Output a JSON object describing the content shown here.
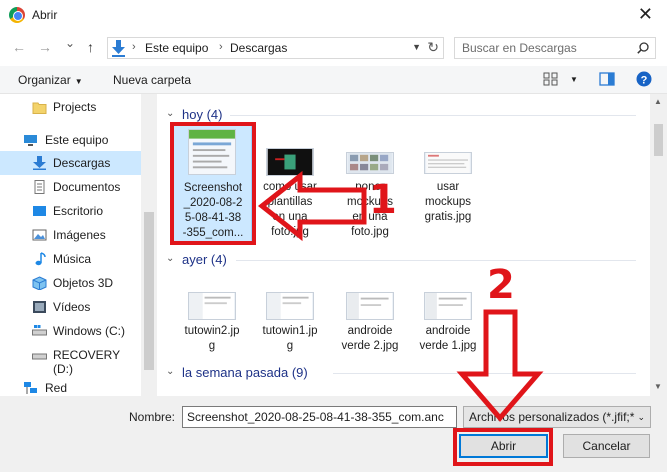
{
  "window": {
    "title": "Abrir",
    "close_glyph": "✕"
  },
  "nav": {
    "back_glyph": "←",
    "forward_glyph": "→",
    "recent_glyph": "⌄",
    "up_glyph": "↑",
    "breadcrumb": [
      "Este equipo",
      "Descargas"
    ],
    "search_placeholder": "Buscar en Descargas"
  },
  "toolbar": {
    "organize": "Organizar",
    "new_folder": "Nueva carpeta"
  },
  "sidebar": {
    "items": [
      {
        "label": "Projects",
        "icon": "folder-icon"
      },
      {
        "label": "Este equipo",
        "icon": "computer-icon"
      },
      {
        "label": "Descargas",
        "icon": "download-icon",
        "active": true
      },
      {
        "label": "Documentos",
        "icon": "documents-icon"
      },
      {
        "label": "Escritorio",
        "icon": "desktop-icon"
      },
      {
        "label": "Imágenes",
        "icon": "pictures-icon"
      },
      {
        "label": "Música",
        "icon": "music-icon"
      },
      {
        "label": "Objetos 3D",
        "icon": "objects3d-icon"
      },
      {
        "label": "Vídeos",
        "icon": "videos-icon"
      },
      {
        "label": "Windows (C:)",
        "icon": "drive-icon"
      },
      {
        "label": "RECOVERY (D:)",
        "icon": "drive-icon"
      },
      {
        "label": "Red",
        "icon": "network-icon"
      }
    ]
  },
  "groups": [
    {
      "header": "hoy (4)",
      "files": [
        {
          "name": [
            "Screenshot",
            "_2020-08-2",
            "5-08-41-38",
            "-355_com..."
          ],
          "selected": true
        },
        {
          "name": [
            "como usar",
            "plantillas",
            "en una",
            "foto.jpg"
          ]
        },
        {
          "name": [
            "poner",
            "mockups",
            "en una",
            "foto.jpg"
          ]
        },
        {
          "name": [
            "usar",
            "mockups",
            "gratis.jpg"
          ]
        }
      ]
    },
    {
      "header": "ayer (4)",
      "files": [
        {
          "name": [
            "tutowin2.jp",
            "g"
          ]
        },
        {
          "name": [
            "tutowin1.jp",
            "g"
          ]
        },
        {
          "name": [
            "androide",
            "verde 2.jpg"
          ]
        },
        {
          "name": [
            "androide",
            "verde 1.jpg"
          ]
        }
      ]
    },
    {
      "header": "la semana pasada (9)",
      "files": []
    }
  ],
  "bottom": {
    "name_label": "Nombre:",
    "name_value": "Screenshot_2020-08-25-08-41-38-355_com.anc",
    "filter_value": "Archivos personalizados (*.jfif;*",
    "open_label": "Abrir",
    "cancel_label": "Cancelar"
  },
  "annotations": {
    "step1": "1",
    "step2": "2",
    "color": "#e0151a"
  }
}
